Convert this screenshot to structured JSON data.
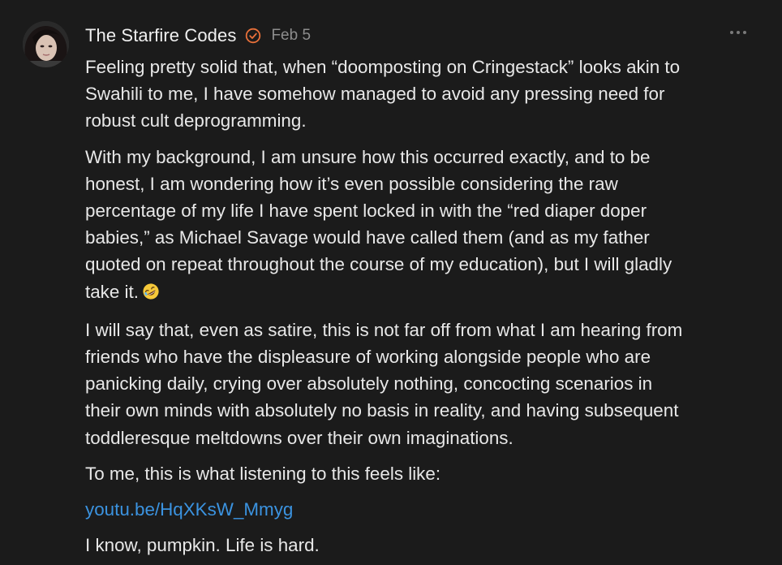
{
  "comment": {
    "author": "The Starfire Codes",
    "date": "Feb 5",
    "verified_icon": "check-circle-icon",
    "more_icon": "ellipsis-icon",
    "accent_color": "#e8703a",
    "link_color": "#3b93e0",
    "paragraphs": [
      {
        "lines": [
          "Feeling pretty solid that, when “doomposting on Cringestack” looks akin to",
          "Swahili to me, I have somehow managed to avoid any pressing need for",
          "robust cult deprogramming."
        ]
      },
      {
        "lines": [
          "With my background, I am unsure how this occurred exactly, and to be",
          "honest, I am wondering how it’s even possible considering the raw",
          "percentage of my life I have spent locked in with the “red diaper doper",
          "babies,” as Michael Savage would have called them (and as my father",
          "quoted on repeat throughout the course of my education), but I will gladly",
          "take it."
        ],
        "emoji": "rolling-on-floor-laughing-emoji"
      },
      {
        "lines": [
          "I will say that, even as satire, this is not far off from what I am hearing from",
          "friends who have the displeasure of working alongside people who are",
          "panicking daily, crying over absolutely nothing, concocting scenarios in",
          "their own minds with absolutely no basis in reality, and having subsequent",
          "toddleresque meltdowns over their own imaginations."
        ]
      },
      {
        "lines": [
          "To me, this is what listening to this feels like:"
        ]
      }
    ],
    "link_text": "youtu.be/HqXKsW_Mmyg",
    "closing": "I know, pumpkin. Life is hard."
  }
}
